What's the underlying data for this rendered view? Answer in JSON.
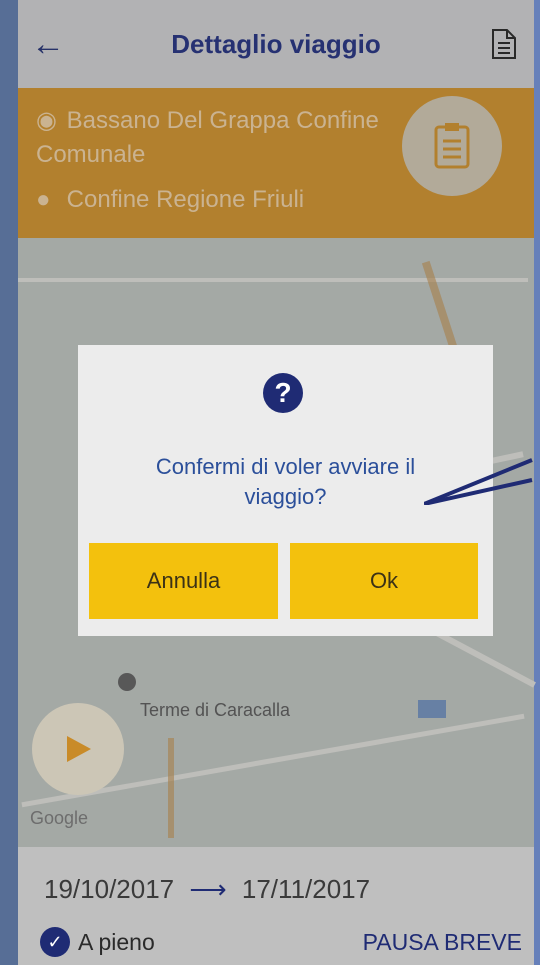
{
  "header": {
    "title": "Dettaglio viaggio",
    "back_icon": "arrow-left-icon",
    "document_icon": "document-icon"
  },
  "route": {
    "origin": "Bassano Del Grappa Confine Comunale",
    "destination": "Confine Regione Friuli",
    "clipboard_icon": "clipboard-icon"
  },
  "map": {
    "labels": [
      "Terme di Caracalla"
    ],
    "provider": "Google"
  },
  "dialog": {
    "icon": "question-icon",
    "message": "Confermi di voler avviare il viaggio?",
    "cancel_label": "Annulla",
    "ok_label": "Ok"
  },
  "footer": {
    "start_date": "19/10/2017",
    "end_date": "17/11/2017",
    "full_load_label": "A pieno",
    "full_load_checked": true,
    "pause_label": "PAUSA BREVE"
  },
  "colors": {
    "primary": "#1f2b74",
    "accent": "#f3c10d",
    "banner": "#c98b28"
  }
}
